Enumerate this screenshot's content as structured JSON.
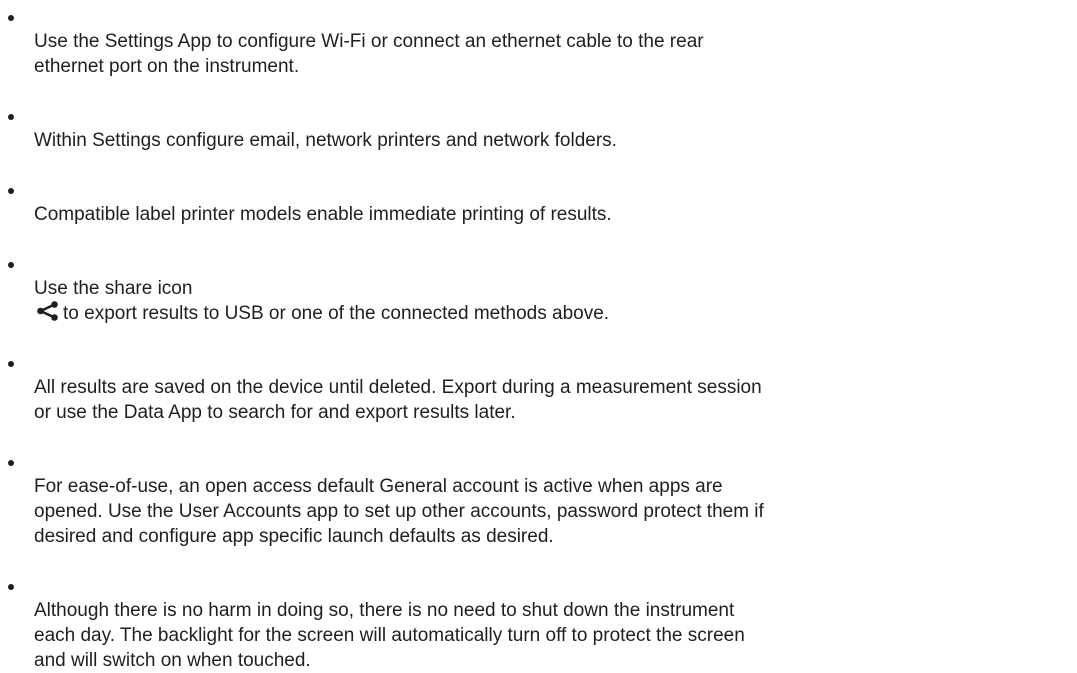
{
  "bullets": [
    {
      "text": "Use the Settings App to configure Wi-Fi or connect an ethernet cable to the rear\nethernet port on the instrument."
    },
    {
      "text": "Within Settings configure email, network printers and network folders."
    },
    {
      "text": "Compatible label printer models enable immediate printing of results."
    },
    {
      "before": "Use the share icon",
      "after": "to export results to USB or one of the connected methods above.",
      "icon": "share-icon"
    },
    {
      "text": "All results are saved on the device until deleted. Export during a measurement session\nor use the Data App to search for and export results later."
    },
    {
      "text": "For ease-of-use, an open access default General account is active when apps are\nopened. Use the User Accounts app to set up other accounts, password protect them if\ndesired and configure app specific launch defaults as desired."
    },
    {
      "text": "Although there is no harm in doing so, there is no need to shut down the instrument\neach day. The backlight for the screen will automatically turn off to protect the screen\nand will switch on when touched."
    }
  ]
}
